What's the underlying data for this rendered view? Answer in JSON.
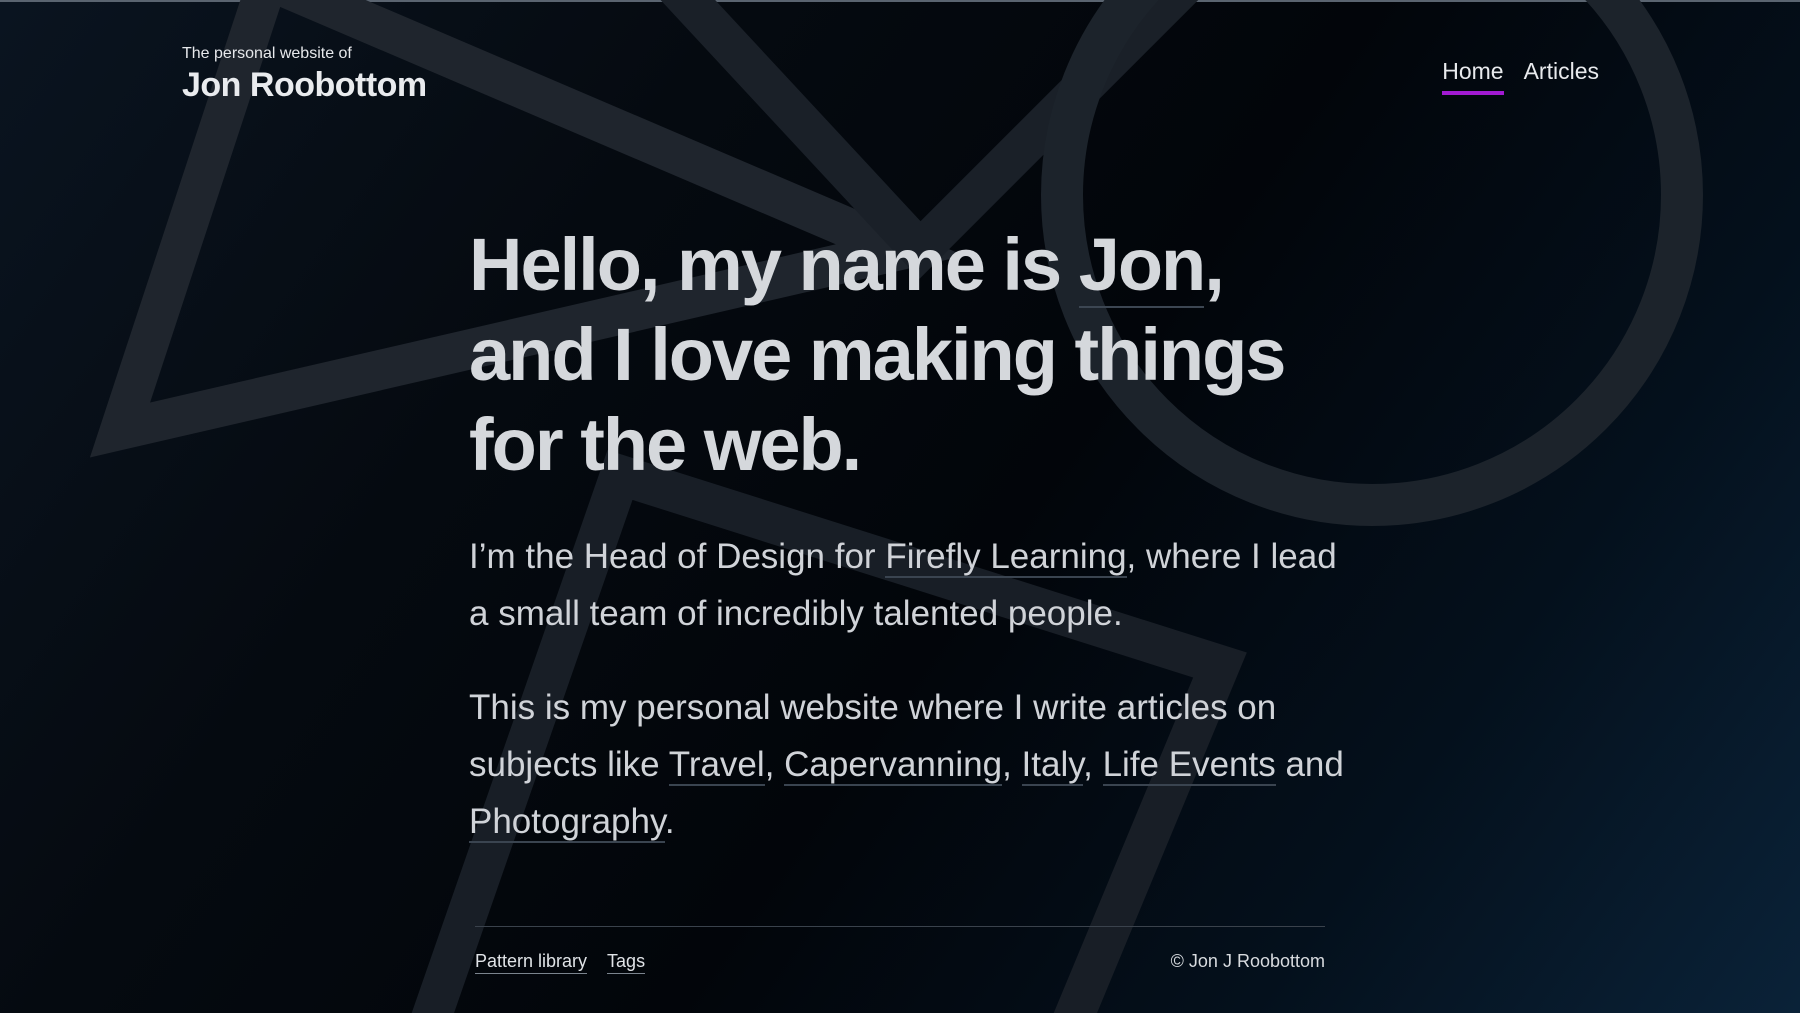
{
  "header": {
    "tagline": "The personal website of",
    "site_name": "Jon Roobottom",
    "nav": [
      {
        "label": "Home",
        "active": true
      },
      {
        "label": "Articles",
        "active": false
      }
    ],
    "nav_active_color": "#a21ad2"
  },
  "hero": {
    "line1_prefix": "Hello, my name is ",
    "name_link": "Jon",
    "line1_suffix": ",",
    "line2": "and I love making things",
    "line3": "for the web."
  },
  "intro": {
    "p1_prefix": "I’m the Head of Design for ",
    "p1_link": "Firefly Learning",
    "p1_suffix": ", where I lead a small team of incredibly talented people.",
    "p2_prefix": "This is my personal website where I write articles on subjects like ",
    "p2_links": [
      "Travel",
      "Capervanning",
      "Italy",
      "Life Events",
      "Photography"
    ],
    "p2_separators": [
      ", ",
      ", ",
      ", ",
      " and "
    ],
    "p2_suffix": "."
  },
  "footer": {
    "links": [
      "Pattern library",
      "Tags"
    ],
    "copyright": "© Jon J Roobottom"
  },
  "colors": {
    "background_dark": "#02050a",
    "background_accent": "#0a2238",
    "text": "#d5d8dc",
    "accent": "#a21ad2"
  }
}
